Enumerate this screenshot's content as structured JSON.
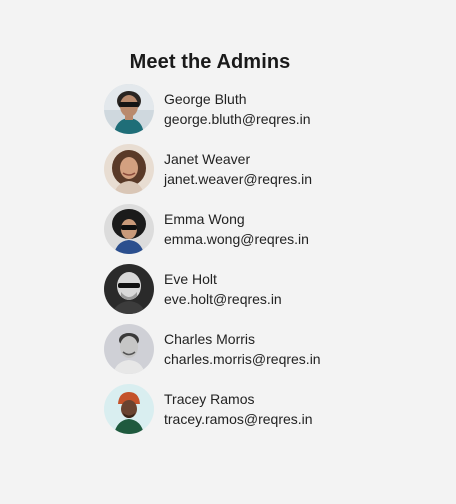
{
  "page": {
    "title": "Meet the Admins"
  },
  "admins": [
    {
      "name": "George Bluth",
      "email": "george.bluth@reqres.in",
      "avatar_icon": "person-photo-icon"
    },
    {
      "name": "Janet Weaver",
      "email": "janet.weaver@reqres.in",
      "avatar_icon": "person-photo-icon"
    },
    {
      "name": "Emma Wong",
      "email": "emma.wong@reqres.in",
      "avatar_icon": "person-photo-icon"
    },
    {
      "name": "Eve Holt",
      "email": "eve.holt@reqres.in",
      "avatar_icon": "person-photo-icon"
    },
    {
      "name": "Charles Morris",
      "email": "charles.morris@reqres.in",
      "avatar_icon": "person-photo-icon"
    },
    {
      "name": "Tracey Ramos",
      "email": "tracey.ramos@reqres.in",
      "avatar_icon": "person-photo-icon"
    }
  ],
  "colors": {
    "background": "#f3f3f3",
    "text": "#222222"
  }
}
